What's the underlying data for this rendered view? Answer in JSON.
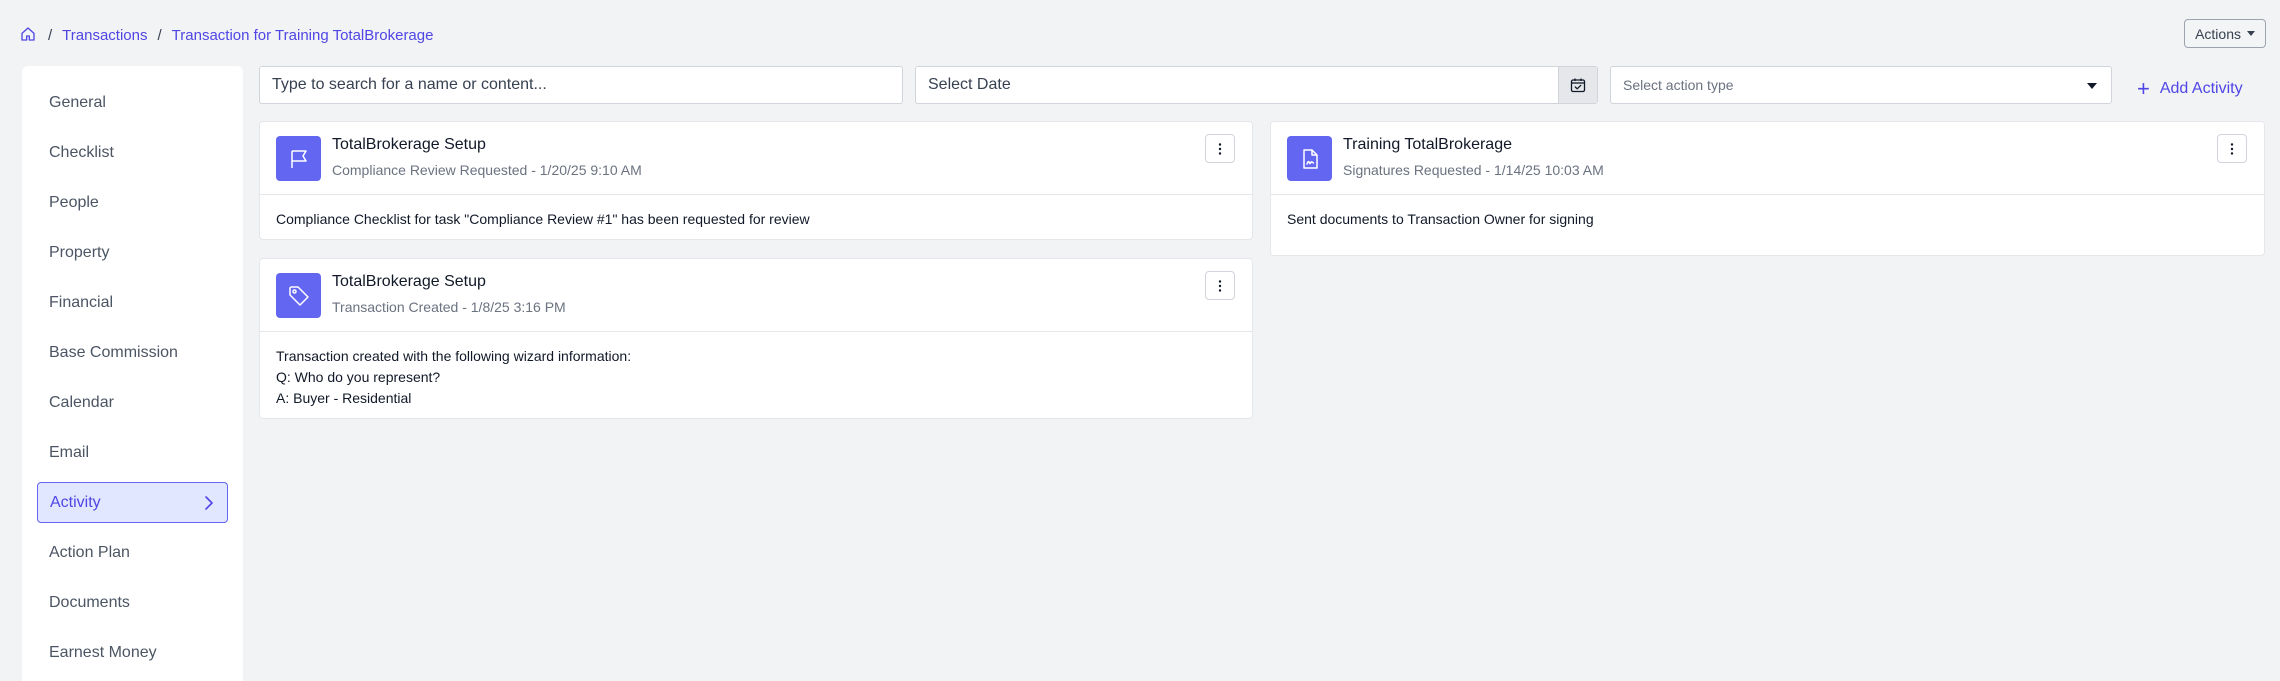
{
  "breadcrumb": {
    "items": [
      "Transactions",
      "Transaction for Training TotalBrokerage"
    ]
  },
  "header": {
    "actions_label": "Actions"
  },
  "sidebar": {
    "items": [
      {
        "label": "General"
      },
      {
        "label": "Checklist"
      },
      {
        "label": "People"
      },
      {
        "label": "Property"
      },
      {
        "label": "Financial"
      },
      {
        "label": "Base Commission"
      },
      {
        "label": "Calendar"
      },
      {
        "label": "Email"
      },
      {
        "label": "Activity",
        "active": true
      },
      {
        "label": "Action Plan"
      },
      {
        "label": "Documents"
      },
      {
        "label": "Earnest Money"
      }
    ]
  },
  "toolbar": {
    "search_placeholder": "Type to search for a name or content...",
    "date_placeholder": "Select Date",
    "action_type_placeholder": "Select action type",
    "add_activity_label": "Add Activity"
  },
  "activities": [
    {
      "icon": "flag-icon",
      "title": "TotalBrokerage Setup",
      "subtitle": "Compliance Review Requested - 1/20/25 9:10 AM",
      "body": [
        "Compliance Checklist for task \"Compliance Review #1\" has been requested for review"
      ]
    },
    {
      "icon": "signature-document-icon",
      "title": "Training TotalBrokerage",
      "subtitle": "Signatures Requested - 1/14/25 10:03 AM",
      "body": [
        "Sent documents to Transaction Owner for signing"
      ]
    },
    {
      "icon": "tag-icon",
      "title": "TotalBrokerage Setup",
      "subtitle": "Transaction Created - 1/8/25 3:16 PM",
      "body": [
        "Transaction created with the following wizard information:",
        "Q: Who do you represent?",
        "A: Buyer - Residential"
      ]
    }
  ],
  "colors": {
    "accent": "#4f46e5",
    "badge": "#6366f1",
    "background": "#f2f3f5"
  }
}
